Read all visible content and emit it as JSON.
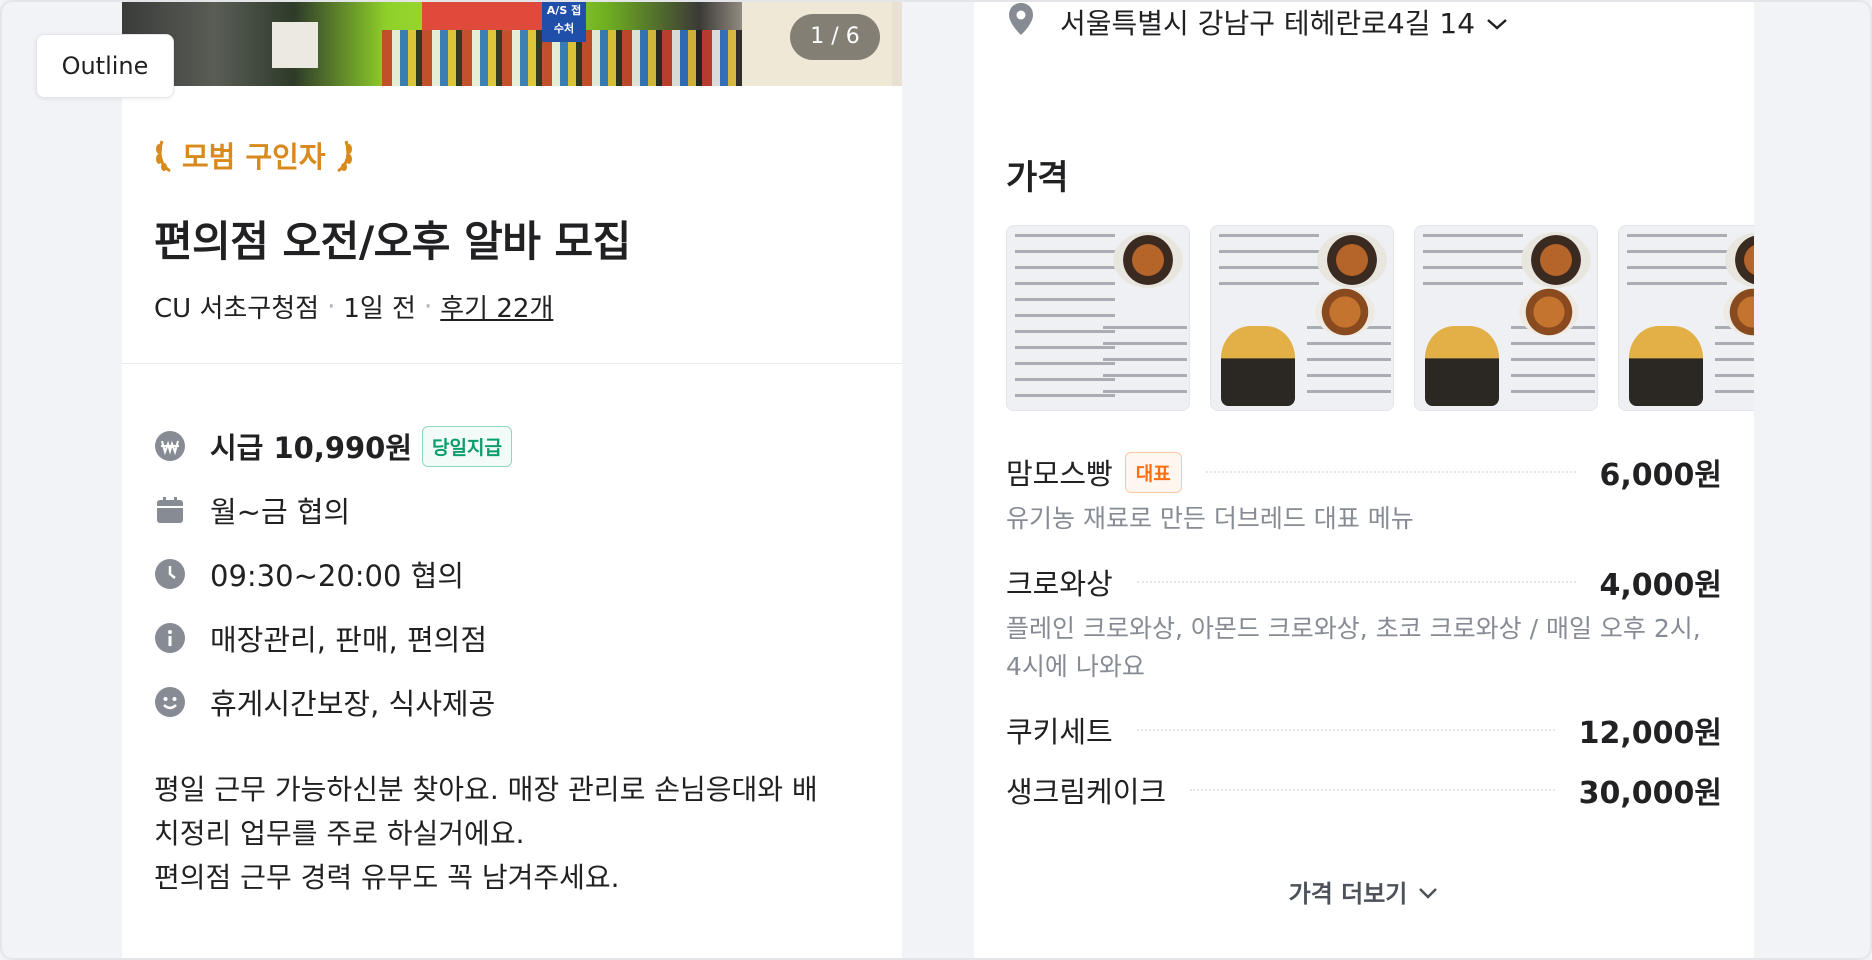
{
  "left": {
    "outline_label": "Outline",
    "photo_counter": "1 / 6",
    "photo_sign_text": "A/S 접수처",
    "badge": "모범 구인자",
    "title": "편의점 오전/오후 알바 모집",
    "meta": {
      "store": "CU 서초구청점",
      "sep1": "·",
      "posted": "1일 전",
      "sep2": "·",
      "reviews": "후기 22개"
    },
    "info": {
      "wage": "시급 10,990원",
      "wage_tag": "당일지급",
      "days": "월~금 협의",
      "hours": "09:30~20:00 협의",
      "tasks": "매장관리, 판매, 편의점",
      "benefits": "휴게시간보장, 식사제공"
    },
    "description": {
      "line1": "평일 근무 가능하신분 찾아요. 매장 관리로 손님응대와 배",
      "line2": "치정리 업무를 주로 하실거에요.",
      "line3": "편의점 근무 경력 유무도 꼭 남겨주세요."
    }
  },
  "right": {
    "address": "서울특별시 강남구 테헤란로4길 14",
    "section_title": "가격",
    "menu": [
      {
        "name": "맘모스빵",
        "tag": "대표",
        "price": "6,000원",
        "desc": "유기농 재료로 만든 더브레드 대표 메뉴"
      },
      {
        "name": "크로와상",
        "tag": "",
        "price": "4,000원",
        "desc": "플레인 크로와상, 아몬드 크로와상, 초코 크로와상 / 매일 오후 2시, 4시에 나와요"
      },
      {
        "name": "쿠키세트",
        "tag": "",
        "price": "12,000원",
        "desc": ""
      },
      {
        "name": "생크림케이크",
        "tag": "",
        "price": "30,000원",
        "desc": ""
      }
    ],
    "more_label": "가격 더보기"
  },
  "colors": {
    "badge": "#d98a1e",
    "pay_tag": "#0a9e6c",
    "menu_tag": "#ff6f0f",
    "icon": "#868b94"
  },
  "icons": [
    "wage-icon",
    "calendar-icon",
    "clock-icon",
    "info-icon",
    "smile-icon",
    "map-pin-icon",
    "chevron-down-icon",
    "laurel-icon"
  ]
}
